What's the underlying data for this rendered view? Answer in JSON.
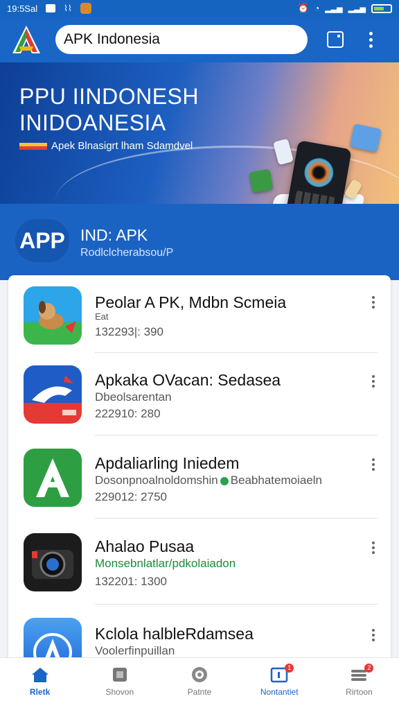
{
  "status_bar": {
    "time": "19:5Sal"
  },
  "app_bar": {
    "search_value": "APK Indonesia"
  },
  "banner": {
    "title_line1": "PPU IINDONESH",
    "title_line2": "INIDOANESIA",
    "subtitle": "Apek Blnasigrt lham Sdamdvel"
  },
  "app_info": {
    "logo_text": "APP",
    "name": "IND: APK",
    "subtitle": "Rodlclcherabsou/P"
  },
  "list": {
    "items": [
      {
        "title": "Peolar A PK, Mdbn Scmeia",
        "line2": "Eat",
        "line3": "132293|: 390",
        "icon": "dog-icon",
        "color": "#2b9fe0"
      },
      {
        "title": "Apkaka OVacan: Sedasea",
        "line2": "Dbeolsarentan",
        "line3": "222910: 280",
        "icon": "shark-icon",
        "color": "#1f5cc6"
      },
      {
        "title": "Apdaliarling Iniedem",
        "line2_a": "Dosonpnoalnoldomshin",
        "line2_b": "Beabhatemoiaeln",
        "line3": "229012: 2750",
        "icon": "letter-a-icon",
        "color": "#2e9e43"
      },
      {
        "title": "Ahalao Pusaa",
        "line2": "Monsebnlatlar/pdkolaiadon",
        "line3": "132201: 1300",
        "icon": "camera-icon",
        "color": "#1c1c1c"
      },
      {
        "title": "Kclola halbleRdamsea",
        "line2": "Voolerfinpuillan",
        "line3": "",
        "icon": "app-store-icon",
        "color": "#2f86e6"
      }
    ]
  },
  "bottom_nav": {
    "items": [
      {
        "label": "Rletk",
        "icon": "home-icon",
        "active": true
      },
      {
        "label": "Shovon",
        "icon": "square-icon",
        "active": false
      },
      {
        "label": "Patnte",
        "icon": "shield-icon",
        "active": false
      },
      {
        "label": "Nontantiet",
        "icon": "update-icon",
        "badge": "1",
        "active": false
      },
      {
        "label": "Rirtoon",
        "icon": "stack-icon",
        "badge": "2",
        "active": false
      }
    ]
  },
  "colors": {
    "primary": "#1a66c6",
    "status_bar": "#1565c0",
    "accent_green": "#1c8a3a"
  }
}
